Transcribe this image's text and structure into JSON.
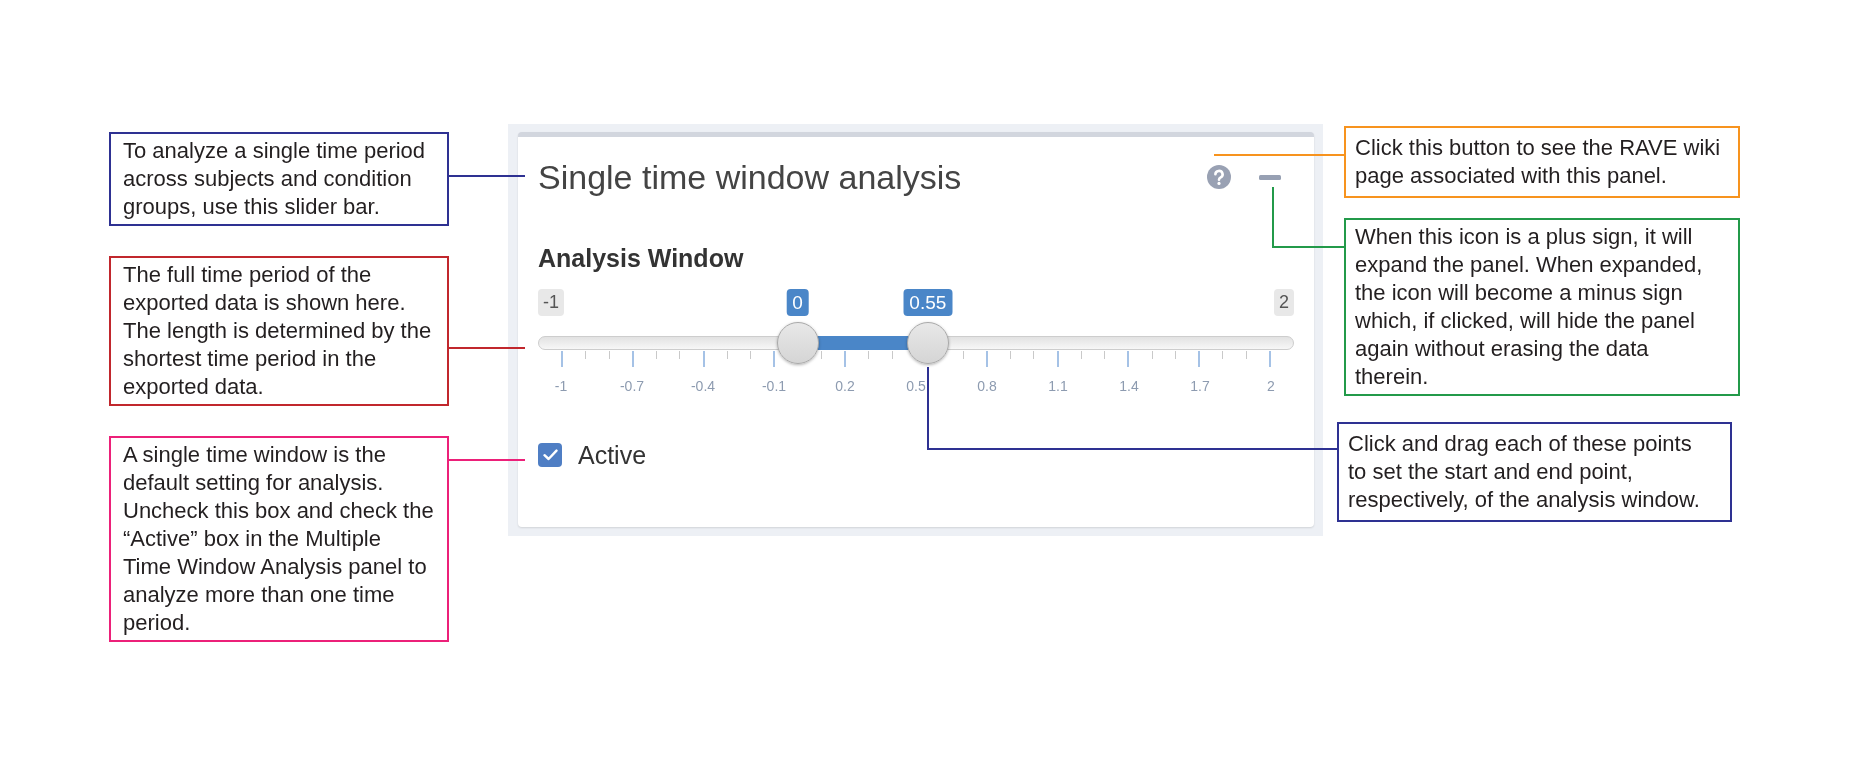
{
  "left_callouts": [
    {
      "text": "To analyze a single time period across subjects and condition groups, use this slider bar.",
      "color": "#2e3192"
    },
    {
      "text": "The full time period of the exported data is shown here. The length is determined by the shortest time period in the exported data.",
      "color": "#c1272d"
    },
    {
      "text": "A single time window is the default setting for analysis. Uncheck this box and check the “Active” box in the Multiple Time Window Analysis panel to analyze more than one time period.",
      "color": "#ec2079"
    }
  ],
  "panel": {
    "title": "Single time window analysis",
    "expanded": true,
    "slider": {
      "label": "Analysis Window",
      "min_label": "-1",
      "max_label": "2",
      "handles": [
        {
          "value": "0",
          "level": 0.3333
        },
        {
          "value": "0.55",
          "level": 0.5167
        }
      ],
      "tick_labels": [
        "-1",
        "-0.7",
        "-0.4",
        "-0.1",
        "0.2",
        "0.5",
        "0.8",
        "1.1",
        "1.4",
        "1.7",
        "2"
      ]
    },
    "checkbox": {
      "label": "Active",
      "checked": true
    }
  },
  "right_callouts": [
    {
      "text": "Click this button to see the RAVE wiki page associated with this panel.",
      "color": "#f7931e"
    },
    {
      "text": "When this icon is a plus sign, it will expand the panel. When expanded, the icon will become a minus sign which, if clicked, will hide the panel again without erasing the data therein.",
      "color": "#239a4a"
    },
    {
      "text": "Click and drag each of these points to set the start and end point, respectively, of the analysis window.",
      "color": "#2e3192"
    }
  ]
}
